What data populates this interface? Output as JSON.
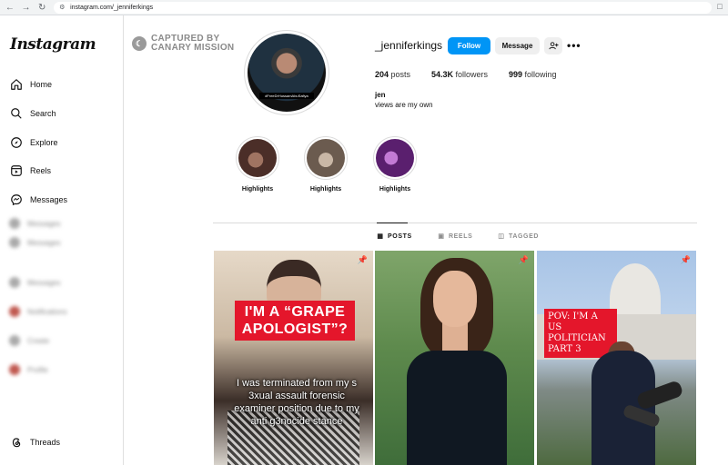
{
  "browser": {
    "url": "instagram.com/_jenniferkings"
  },
  "sidebar": {
    "logo": "Instagram",
    "items": [
      {
        "label": "Home",
        "icon": "home-icon"
      },
      {
        "label": "Search",
        "icon": "search-icon"
      },
      {
        "label": "Explore",
        "icon": "compass-icon"
      },
      {
        "label": "Reels",
        "icon": "reels-icon"
      },
      {
        "label": "Messages",
        "icon": "messenger-icon"
      }
    ],
    "blurred_items": [
      "Messages",
      "Messages",
      "Messages",
      "Notifications",
      "Create",
      "Profile"
    ],
    "threads": {
      "label": "Threads",
      "icon": "threads-icon"
    }
  },
  "watermark": {
    "line1": "CAPTURED BY",
    "line2": "CANARY MISSION"
  },
  "profile": {
    "avatar_caption": "#FreeDrHussamAbuSafiya",
    "username": "_jenniferkings",
    "follow_label": "Follow",
    "message_label": "Message",
    "posts_count": "204",
    "posts_label": "posts",
    "followers_count": "54.3K",
    "followers_label": "followers",
    "following_count": "999",
    "following_label": "following",
    "bio_name": "jen",
    "bio_text": "views are my own"
  },
  "highlights": [
    {
      "label": "Highlights",
      "color_a": "#4b2e28",
      "color_b": "#a07462"
    },
    {
      "label": "Highlights",
      "color_a": "#6b5b4f",
      "color_b": "#c9b7a6"
    },
    {
      "label": "Highlights",
      "color_a": "#5a1f6e",
      "color_b": "#c27ad4"
    }
  ],
  "tabs": [
    {
      "label": "POSTS",
      "icon": "grid-icon",
      "active": true
    },
    {
      "label": "REELS",
      "icon": "reels-icon",
      "active": false
    },
    {
      "label": "TAGGED",
      "icon": "tagged-icon",
      "active": false
    }
  ],
  "posts": [
    {
      "sticker": "I'M A “GRAPE APOLOGIST”?",
      "caption": "I was terminated from my s 3xual assault forensic examiner position due to my anti g3nocide stance",
      "pinned": true
    },
    {
      "pinned": true
    },
    {
      "sticker": "POV: I'M A US POLITICIAN PART 3",
      "pinned": true
    }
  ]
}
